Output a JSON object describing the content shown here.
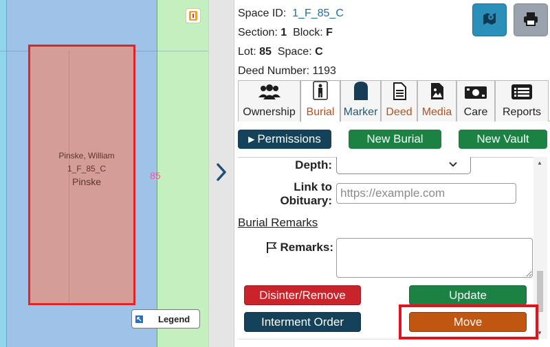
{
  "map": {
    "plot": {
      "owner_name": "Pinske, William",
      "space_code": "1_F_85_C",
      "family_name": "Pinske"
    },
    "lot_number": "85",
    "legend_label": "Legend",
    "colors": {
      "plot_fill": "#d49d96",
      "plot_border": "#e0242a",
      "lot_number": "#ff4fa0"
    }
  },
  "panel": {
    "space_id_label": "Space ID:",
    "space_id_value": "1_F_85_C",
    "section_label": "Section:",
    "section_value": "1",
    "block_label": "Block:",
    "block_value": "F",
    "lot_label": "Lot:",
    "lot_value": "85",
    "space_label": "Space:",
    "space_value": "C",
    "deed_label": "Deed Number:",
    "deed_value": "1193",
    "tabs": [
      {
        "label": "Ownership",
        "icon": "users-icon",
        "color": "#222222"
      },
      {
        "label": "Burial",
        "icon": "person-icon",
        "color": "#b8501a",
        "active": true
      },
      {
        "label": "Marker",
        "icon": "headstone-icon",
        "color": "#1e5a7a"
      },
      {
        "label": "Deed",
        "icon": "document-icon",
        "color": "#b8501a"
      },
      {
        "label": "Media",
        "icon": "image-file-icon",
        "color": "#b8501a"
      },
      {
        "label": "Care",
        "icon": "money-icon",
        "color": "#222222"
      },
      {
        "label": "Reports",
        "icon": "list-icon",
        "color": "#222222"
      }
    ],
    "buttons": {
      "permissions": "Permissions",
      "new_burial": "New Burial",
      "new_vault": "New Vault",
      "disinter": "Disinter/Remove",
      "update": "Update",
      "interment_order": "Interment Order",
      "move": "Move"
    },
    "form": {
      "depth_label": "Depth:",
      "depth_value": "",
      "obituary_label_1": "Link to",
      "obituary_label_2": "Obituary:",
      "obituary_placeholder": "https://example.com",
      "burial_remarks_link": "Burial Remarks",
      "remarks_label": "Remarks:",
      "remarks_value": ""
    }
  }
}
